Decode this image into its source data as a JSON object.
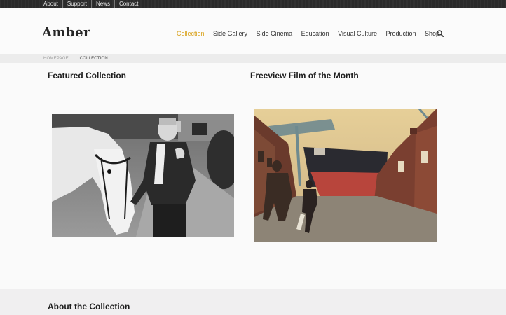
{
  "topbar": {
    "links": [
      "About",
      "Support",
      "News",
      "Contact"
    ]
  },
  "header": {
    "logo": "Amber",
    "nav": [
      "Collection",
      "Side Gallery",
      "Side Cinema",
      "Education",
      "Visual Culture",
      "Production",
      "Shop"
    ],
    "active_nav": "Collection",
    "search_icon": "search-icon"
  },
  "breadcrumb": {
    "home": "HOMEPAGE",
    "current": "COLLECTION"
  },
  "main": {
    "featured_title": "Featured Collection",
    "freeview_title": "Freeview Film of the Month"
  },
  "about": {
    "title": "About the Collection"
  },
  "colors": {
    "accent": "#d9a21b",
    "topbar": "#2b2b2b",
    "breadcrumb_bar": "#ececec"
  }
}
